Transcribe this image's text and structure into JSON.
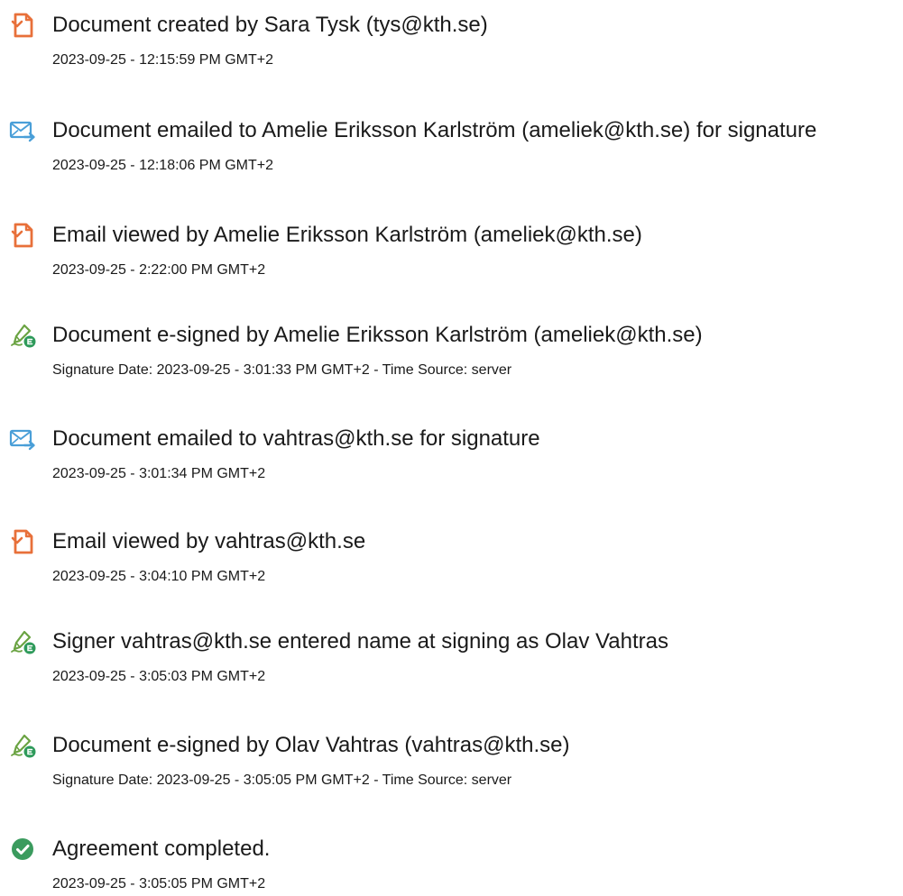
{
  "events": [
    {
      "icon": "document-icon",
      "title": "Document created by Sara Tysk (tys@kth.se)",
      "detail": "2023-09-25 - 12:15:59 PM GMT+2"
    },
    {
      "icon": "email-sent-icon",
      "title": "Document emailed to Amelie Eriksson Karlström (ameliek@kth.se) for signature",
      "detail": "2023-09-25 - 12:18:06 PM GMT+2"
    },
    {
      "icon": "document-icon",
      "title": "Email viewed by Amelie Eriksson Karlström (ameliek@kth.se)",
      "detail": "2023-09-25 - 2:22:00 PM GMT+2"
    },
    {
      "icon": "pen-sign-icon",
      "title": "Document e-signed by Amelie Eriksson Karlström (ameliek@kth.se)",
      "detail": "Signature Date: 2023-09-25 - 3:01:33 PM GMT+2 - Time Source: server"
    },
    {
      "icon": "email-sent-icon",
      "title": "Document emailed to vahtras@kth.se for signature",
      "detail": "2023-09-25 - 3:01:34 PM GMT+2"
    },
    {
      "icon": "document-icon",
      "title": "Email viewed by vahtras@kth.se",
      "detail": "2023-09-25 - 3:04:10 PM GMT+2"
    },
    {
      "icon": "pen-sign-icon",
      "title": "Signer vahtras@kth.se entered name at signing as Olav Vahtras",
      "detail": "2023-09-25 - 3:05:03 PM GMT+2"
    },
    {
      "icon": "pen-sign-icon",
      "title": "Document e-signed by Olav Vahtras (vahtras@kth.se)",
      "detail": "Signature Date: 2023-09-25 - 3:05:05 PM GMT+2 - Time Source: server"
    },
    {
      "icon": "checkmark-circle-icon",
      "title": "Agreement completed.",
      "detail": "2023-09-25 - 3:05:05 PM GMT+2"
    }
  ],
  "colors": {
    "document": "#e8703a",
    "email": "#4a9fd8",
    "sign_pen": "#6aa342",
    "sign_badge": "#2e9a5a",
    "check": "#3b9b5e",
    "text": "#1a1a1a"
  }
}
